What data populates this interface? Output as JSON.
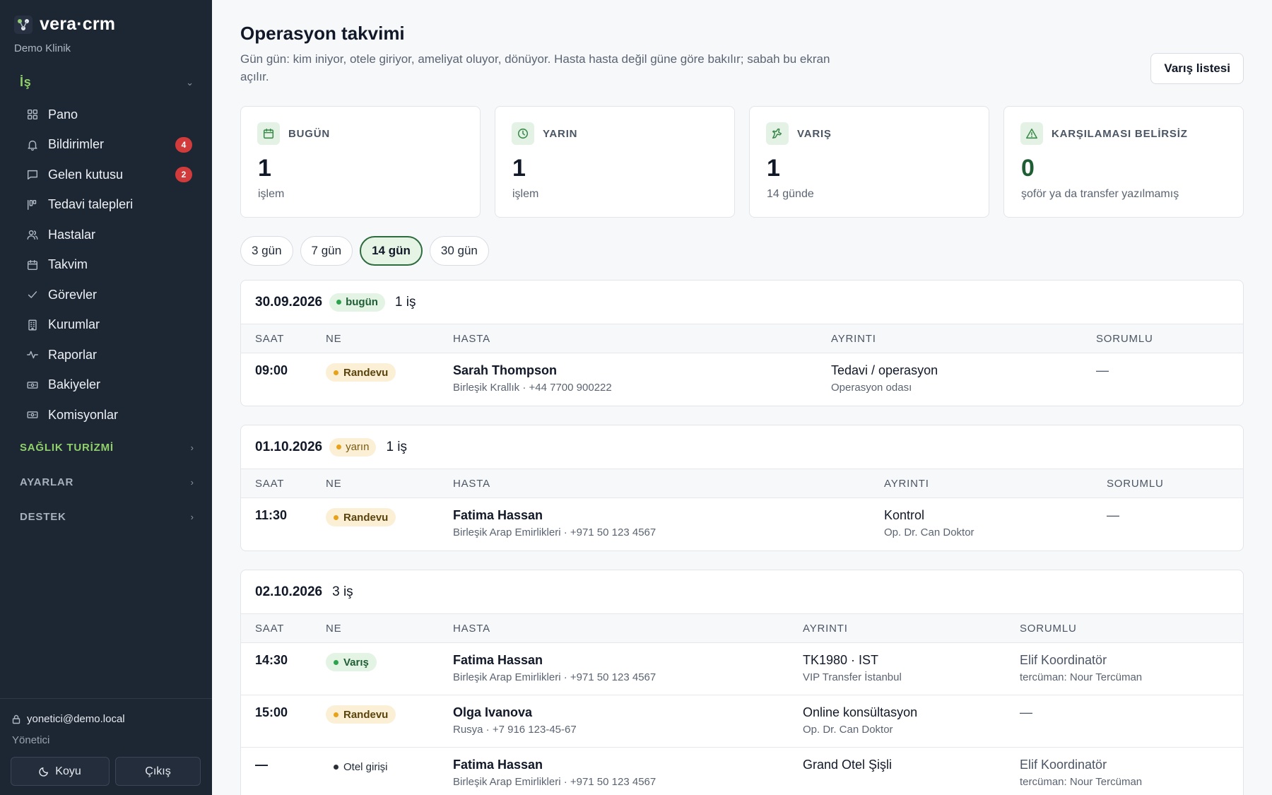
{
  "app": {
    "name": "vera·crm",
    "org": "Demo Klinik"
  },
  "sidebar": {
    "group_open": "İş",
    "items": [
      {
        "label": "Pano",
        "icon": "grid-icon"
      },
      {
        "label": "Bildirimler",
        "icon": "bell-icon",
        "badge": "4"
      },
      {
        "label": "Gelen kutusu",
        "icon": "message-icon",
        "badge": "2"
      },
      {
        "label": "Tedavi talepleri",
        "icon": "kanban-icon"
      },
      {
        "label": "Hastalar",
        "icon": "users-icon"
      },
      {
        "label": "Takvim",
        "icon": "calendar-icon"
      },
      {
        "label": "Görevler",
        "icon": "check-icon"
      },
      {
        "label": "Kurumlar",
        "icon": "building-icon"
      },
      {
        "label": "Raporlar",
        "icon": "activity-icon"
      },
      {
        "label": "Bakiyeler",
        "icon": "banknote-icon"
      },
      {
        "label": "Komisyonlar",
        "icon": "banknote-icon"
      }
    ],
    "groups": [
      "SAĞLIK TURİZMİ",
      "AYARLAR",
      "DESTEK"
    ],
    "user_email": "yonetici@demo.local",
    "user_role": "Yönetici",
    "theme_btn": "Koyu",
    "logout_btn": "Çıkış"
  },
  "header": {
    "title": "Operasyon takvimi",
    "description": "Gün gün: kim iniyor, otele giriyor, ameliyat oluyor, dönüyor. Hasta hasta değil güne göre bakılır; sabah bu ekran açılır.",
    "arrival_list_btn": "Varış listesi"
  },
  "stats": [
    {
      "label": "BUGÜN",
      "value": "1",
      "sub": "işlem",
      "icon": "calendar-icon"
    },
    {
      "label": "YARIN",
      "value": "1",
      "sub": "işlem",
      "icon": "clock-icon"
    },
    {
      "label": "VARIŞ",
      "value": "1",
      "sub": "14 günde",
      "icon": "plane-icon"
    },
    {
      "label": "KARŞILAMASI BELİRSİZ",
      "value": "0",
      "sub": "şoför ya da transfer yazılmamış",
      "icon": "alert-icon"
    }
  ],
  "ranges": [
    "3 gün",
    "7 gün",
    "14 gün",
    "30 gün"
  ],
  "active_range": "14 gün",
  "columns": {
    "time": "SAAT",
    "what": "NE",
    "patient": "HASTA",
    "detail": "AYRINTI",
    "owner": "SORUMLU"
  },
  "days": [
    {
      "date": "30.09.2026",
      "tag": "bugün",
      "count": "1 iş",
      "rows": [
        {
          "time": "09:00",
          "type": "Randevu",
          "patient": "Sarah Thompson",
          "patient_sub": "Birleşik Krallık · +44 7700 900222",
          "detail": "Tedavi / operasyon",
          "detail_sub": "Operasyon odası",
          "owner": "—",
          "owner_sub": ""
        }
      ]
    },
    {
      "date": "01.10.2026",
      "tag": "yarın",
      "count": "1 iş",
      "rows": [
        {
          "time": "11:30",
          "type": "Randevu",
          "patient": "Fatima Hassan",
          "patient_sub": "Birleşik Arap Emirlikleri · +971 50 123 4567",
          "detail": "Kontrol",
          "detail_sub": "Op. Dr. Can Doktor",
          "owner": "—",
          "owner_sub": ""
        }
      ]
    },
    {
      "date": "02.10.2026",
      "tag": "",
      "count": "3 iş",
      "rows": [
        {
          "time": "14:30",
          "type": "Varış",
          "patient": "Fatima Hassan",
          "patient_sub": "Birleşik Arap Emirlikleri · +971 50 123 4567",
          "detail": "TK1980 · IST",
          "detail_sub": "VIP Transfer İstanbul",
          "owner": "Elif Koordinatör",
          "owner_sub": "tercüman: Nour Tercüman"
        },
        {
          "time": "15:00",
          "type": "Randevu",
          "patient": "Olga Ivanova",
          "patient_sub": "Rusya · +7 916 123-45-67",
          "detail": "Online konsültasyon",
          "detail_sub": "Op. Dr. Can Doktor",
          "owner": "—",
          "owner_sub": ""
        },
        {
          "time": "—",
          "type": "Otel girişi",
          "patient": "Fatima Hassan",
          "patient_sub": "Birleşik Arap Emirlikleri · +971 50 123 4567",
          "detail": "Grand Otel Şişli",
          "detail_sub": "",
          "owner": "Elif Koordinatör",
          "owner_sub": "tercüman: Nour Tercüman"
        }
      ]
    }
  ]
}
